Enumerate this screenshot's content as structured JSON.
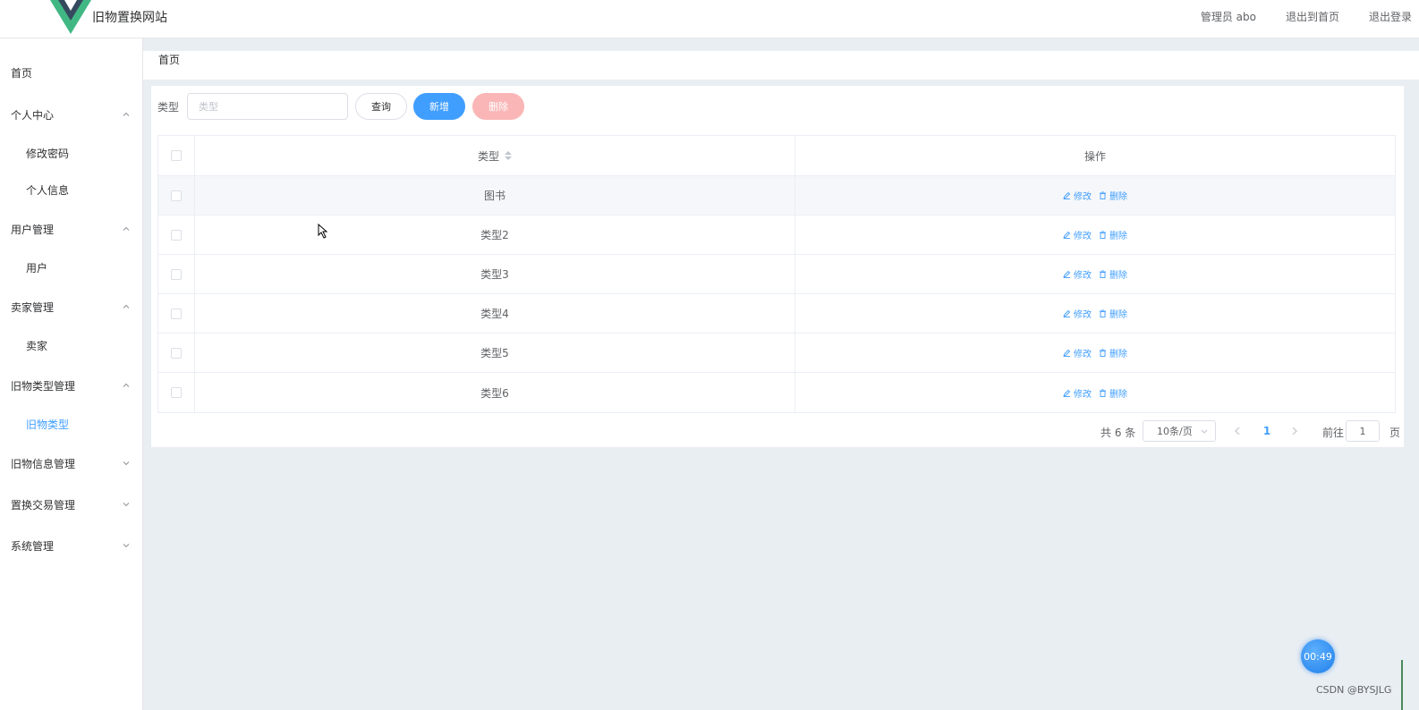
{
  "header": {
    "site_title": "旧物置换网站",
    "user": "管理员 abo",
    "back_home": "退出到首页",
    "logout": "退出登录",
    "logo_colors": [
      "#41b883",
      "#35495e"
    ]
  },
  "sidebar": {
    "items": [
      {
        "label": "首页",
        "level": "top"
      },
      {
        "label": "个人中心",
        "level": "top",
        "expanded": true
      },
      {
        "label": "修改密码",
        "level": "sub"
      },
      {
        "label": "个人信息",
        "level": "sub"
      },
      {
        "label": "用户管理",
        "level": "top",
        "expanded": true
      },
      {
        "label": "用户",
        "level": "sub"
      },
      {
        "label": "卖家管理",
        "level": "top",
        "expanded": true
      },
      {
        "label": "卖家",
        "level": "sub"
      },
      {
        "label": "旧物类型管理",
        "level": "top",
        "expanded": true
      },
      {
        "label": "旧物类型",
        "level": "sub",
        "active": true
      },
      {
        "label": "旧物信息管理",
        "level": "top",
        "expanded": false
      },
      {
        "label": "置换交易管理",
        "level": "top",
        "expanded": false
      },
      {
        "label": "系统管理",
        "level": "top",
        "expanded": false
      }
    ]
  },
  "breadcrumb": "首页",
  "search": {
    "label": "类型",
    "placeholder": "类型",
    "value": "",
    "query_label": "查询",
    "add_label": "新增",
    "delete_label": "删除"
  },
  "table": {
    "col_type": "类型",
    "col_op": "操作",
    "edit_label": "修改",
    "delete_label": "删除",
    "rows": [
      {
        "type": "图书"
      },
      {
        "type": "类型2"
      },
      {
        "type": "类型3"
      },
      {
        "type": "类型4"
      },
      {
        "type": "类型5"
      },
      {
        "type": "类型6"
      }
    ]
  },
  "pagination": {
    "total": "共 6 条",
    "page_size": "10条/页",
    "current": "1",
    "goto": "前往",
    "goto_value": "1",
    "page_suffix": "页"
  },
  "overlay": {
    "timer": "00:49",
    "watermark": "CSDN @BYSJLG"
  },
  "colors": {
    "primary": "#409eff",
    "danger_disabled": "#fab6b6",
    "background": "#e9eef3"
  }
}
